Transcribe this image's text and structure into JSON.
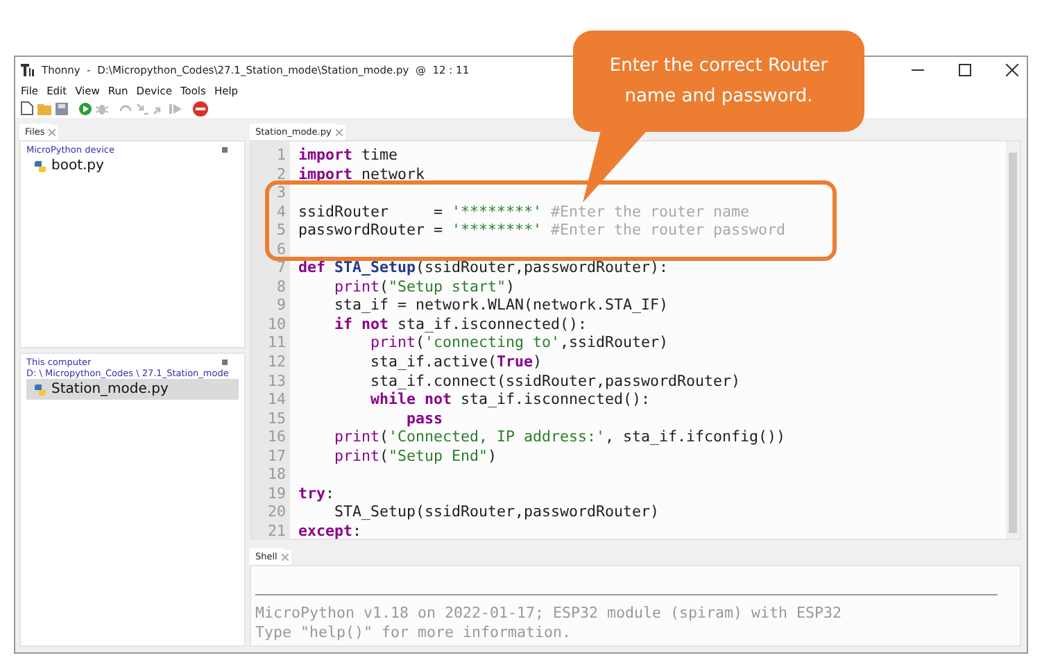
{
  "window": {
    "title": "Thonny  -  D:\\Micropython_Codes\\27.1_Station_mode\\Station_mode.py  @  12 : 11"
  },
  "menu": [
    "File",
    "Edit",
    "View",
    "Run",
    "Device",
    "Tools",
    "Help"
  ],
  "files": {
    "tab": "Files",
    "device": {
      "title": "MicroPython device",
      "items": [
        {
          "name": "boot.py",
          "selected": false
        }
      ]
    },
    "computer": {
      "title": "This computer",
      "path": "D: \\ Micropython_Codes \\ 27.1_Station_mode",
      "items": [
        {
          "name": "Station_mode.py",
          "selected": true
        }
      ]
    }
  },
  "editor": {
    "tab": "Station_mode.py",
    "lines": [
      {
        "number": "1",
        "segments": [
          {
            "kind": "kw",
            "text": "import"
          },
          {
            "kind": "txt",
            "text": " time"
          }
        ]
      },
      {
        "number": "2",
        "segments": [
          {
            "kind": "kw",
            "text": "import"
          },
          {
            "kind": "txt",
            "text": " network"
          }
        ]
      },
      {
        "number": "3"
      },
      {
        "number": "4",
        "segments": [
          {
            "kind": "txt",
            "text": "ssidRouter     = "
          },
          {
            "kind": "str",
            "text": "'********'"
          },
          {
            "kind": "cmt",
            "text": " #Enter the router name"
          }
        ]
      },
      {
        "number": "5",
        "segments": [
          {
            "kind": "txt",
            "text": "passwordRouter = "
          },
          {
            "kind": "str",
            "text": "'********'"
          },
          {
            "kind": "cmt",
            "text": " #Enter the router password"
          }
        ]
      },
      {
        "number": "6"
      },
      {
        "number": "7",
        "segments": [
          {
            "kind": "kw",
            "text": "def "
          },
          {
            "kind": "fn",
            "text": "STA_Setup"
          },
          {
            "kind": "txt",
            "text": "(ssidRouter,passwordRouter):"
          }
        ]
      },
      {
        "number": "8",
        "segments": [
          {
            "kind": "bi",
            "text": "    print"
          },
          {
            "kind": "txt",
            "text": "("
          },
          {
            "kind": "str",
            "text": "\"Setup start\""
          },
          {
            "kind": "txt",
            "text": ")"
          }
        ]
      },
      {
        "number": "9",
        "segments": [
          {
            "kind": "txt",
            "text": "    sta_if = network.WLAN(network.STA_IF)"
          }
        ]
      },
      {
        "number": "10",
        "segments": [
          {
            "kind": "kw",
            "text": "    if not"
          },
          {
            "kind": "txt",
            "text": " sta_if.isconnected():"
          }
        ]
      },
      {
        "number": "11",
        "segments": [
          {
            "kind": "bi",
            "text": "        print"
          },
          {
            "kind": "txt",
            "text": "("
          },
          {
            "kind": "str",
            "text": "'connecting to'"
          },
          {
            "kind": "txt",
            "text": ",ssidRouter)"
          }
        ]
      },
      {
        "number": "12",
        "segments": [
          {
            "kind": "txt",
            "text": "        sta_if.active("
          },
          {
            "kind": "kw",
            "text": "True"
          },
          {
            "kind": "txt",
            "text": ")"
          }
        ]
      },
      {
        "number": "13",
        "segments": [
          {
            "kind": "txt",
            "text": "        sta_if.connect(ssidRouter,passwordRouter)"
          }
        ]
      },
      {
        "number": "14",
        "segments": [
          {
            "kind": "kw",
            "text": "        while not"
          },
          {
            "kind": "txt",
            "text": " sta_if.isconnected():"
          }
        ]
      },
      {
        "number": "15",
        "segments": [
          {
            "kind": "kw",
            "text": "            pass"
          }
        ]
      },
      {
        "number": "16",
        "segments": [
          {
            "kind": "bi",
            "text": "    print"
          },
          {
            "kind": "txt",
            "text": "("
          },
          {
            "kind": "str",
            "text": "'Connected, IP address:'"
          },
          {
            "kind": "txt",
            "text": ", sta_if.ifconfig())"
          }
        ]
      },
      {
        "number": "17",
        "segments": [
          {
            "kind": "bi",
            "text": "    print"
          },
          {
            "kind": "txt",
            "text": "("
          },
          {
            "kind": "str",
            "text": "\"Setup End\""
          },
          {
            "kind": "txt",
            "text": ")"
          }
        ]
      },
      {
        "number": "18"
      },
      {
        "number": "19",
        "segments": [
          {
            "kind": "kw",
            "text": "try"
          },
          {
            "kind": "txt",
            "text": ":"
          }
        ]
      },
      {
        "number": "20",
        "segments": [
          {
            "kind": "txt",
            "text": "    STA_Setup(ssidRouter,passwordRouter)"
          }
        ]
      },
      {
        "number": "21",
        "segments": [
          {
            "kind": "kw",
            "text": "except"
          },
          {
            "kind": "txt",
            "text": ":"
          }
        ]
      }
    ]
  },
  "shell": {
    "tab": "Shell",
    "lines": [
      "MicroPython v1.18 on 2022-01-17; ESP32 module (spiram) with ESP32",
      "Type \"help()\" for more information."
    ]
  },
  "callout": {
    "text": "Enter the correct Router name and password."
  }
}
